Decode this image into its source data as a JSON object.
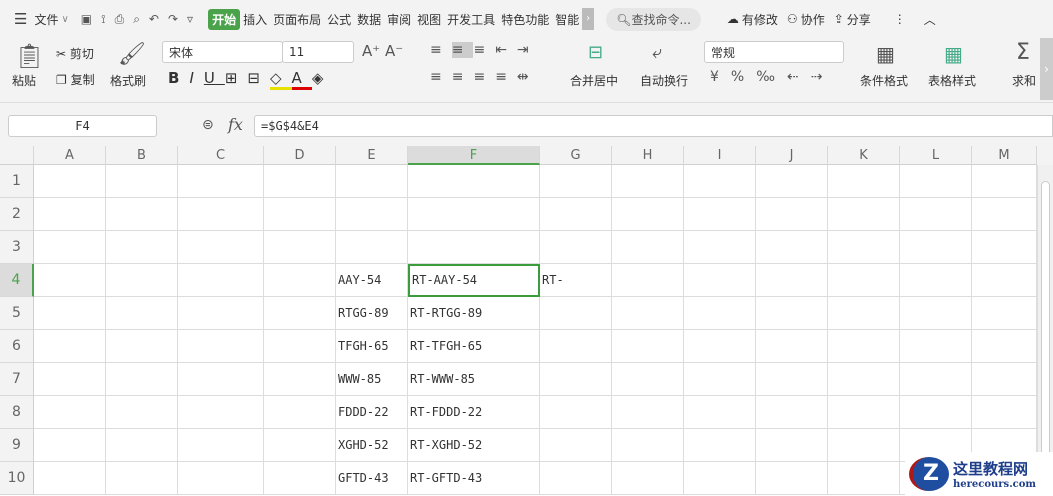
{
  "menu": {
    "file": "文件",
    "tabs": [
      "开始",
      "插入",
      "页面布局",
      "公式",
      "数据",
      "审阅",
      "视图",
      "开发工具",
      "特色功能",
      "智能"
    ],
    "search": "查找命令...",
    "modified": "有修改",
    "collab": "协作",
    "share": "分享"
  },
  "ribbon": {
    "paste": "粘贴",
    "cut": "剪切",
    "copy": "复制",
    "format_painter": "格式刷",
    "font": "宋体",
    "size": "11",
    "merge": "合并居中",
    "wrap": "自动换行",
    "number_format": "常规",
    "cond_format": "条件格式",
    "table_style": "表格样式",
    "sum": "求和"
  },
  "formula_bar": {
    "name_box": "F4",
    "fx": "fx",
    "formula": "=$G$4&E4"
  },
  "columns": [
    "A",
    "B",
    "C",
    "D",
    "E",
    "F",
    "G",
    "H",
    "I",
    "J",
    "K",
    "L",
    "M"
  ],
  "rows": [
    "1",
    "2",
    "3",
    "4",
    "5",
    "6",
    "7",
    "8",
    "9",
    "10"
  ],
  "cells": {
    "E4": "AAY-54",
    "F4": "RT-AAY-54",
    "G4": "RT-",
    "E5": "RTGG-89",
    "F5": "RT-RTGG-89",
    "E6": "TFGH-65",
    "F6": "RT-TFGH-65",
    "E7": "WWW-85",
    "F7": "RT-WWW-85",
    "E8": "FDDD-22",
    "F8": "RT-FDDD-22",
    "E9": "XGHD-52",
    "F9": "RT-XGHD-52",
    "E10": "GFTD-43",
    "F10": "RT-GFTD-43"
  },
  "selected": "F4",
  "watermark": {
    "title": "这里教程网",
    "url": "herecours.com"
  },
  "colors": {
    "accent": "#4aa34a"
  }
}
